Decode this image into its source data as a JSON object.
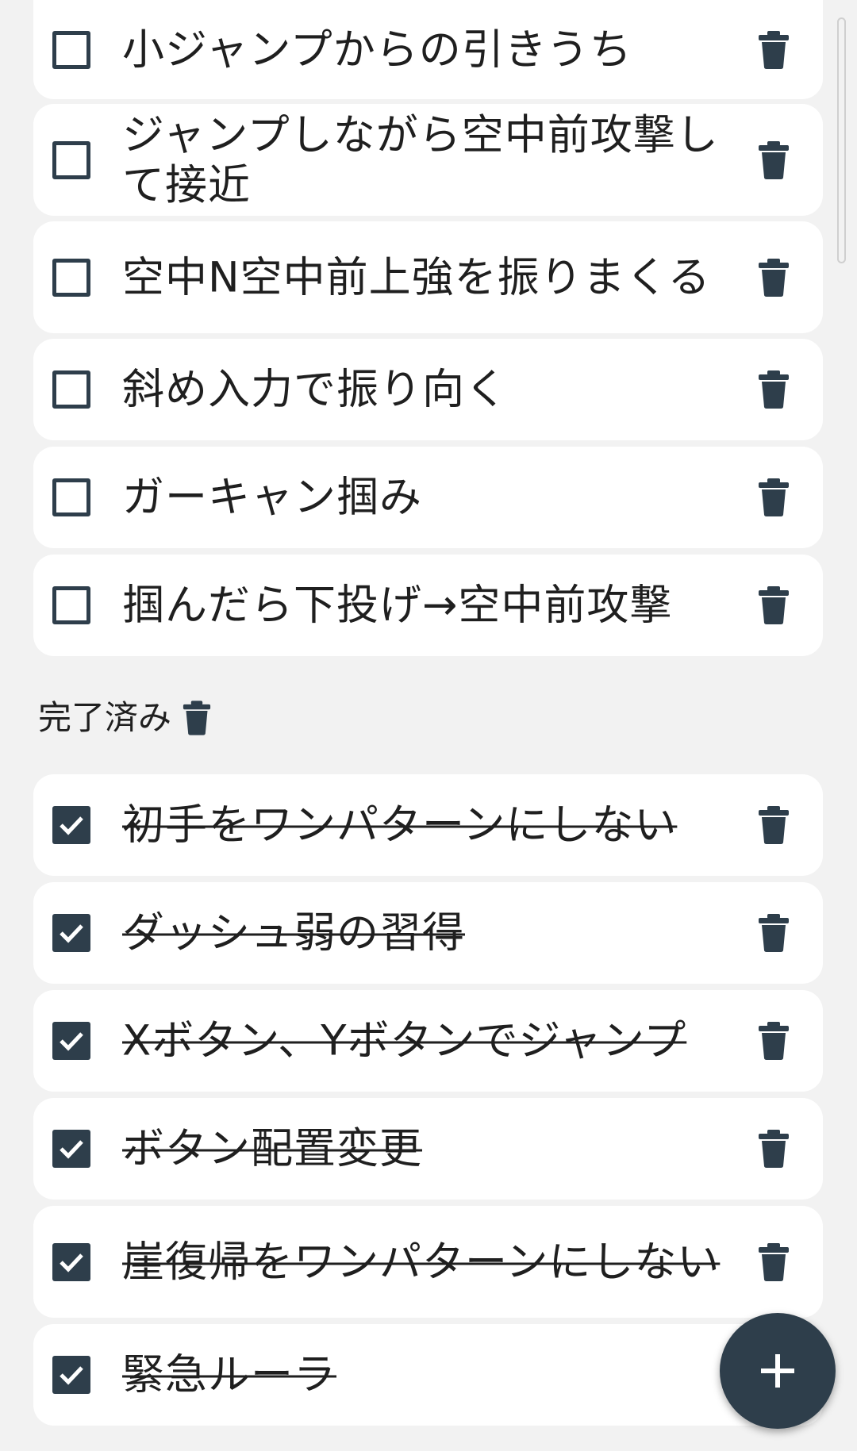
{
  "active_tasks": [
    {
      "label": "小ジャンプからの引きうち",
      "checked": false
    },
    {
      "label": "ジャンプしながら空中前攻撃して接近",
      "checked": false
    },
    {
      "label": "空中N空中前上強を振りまくる",
      "checked": false
    },
    {
      "label": "斜め入力で振り向く",
      "checked": false
    },
    {
      "label": "ガーキャン掴み",
      "checked": false
    },
    {
      "label": "掴んだら下投げ→空中前攻撃",
      "checked": false
    }
  ],
  "completed_section": {
    "title": "完了済み",
    "icon": "trash-icon"
  },
  "completed_tasks": [
    {
      "label": "初手をワンパターンにしない",
      "checked": true
    },
    {
      "label": "ダッシュ弱の習得",
      "checked": true
    },
    {
      "label": "Xボタン、Yボタンでジャンプ",
      "checked": true
    },
    {
      "label": "ボタン配置変更",
      "checked": true
    },
    {
      "label": "崖復帰をワンパターンにしない",
      "checked": true
    },
    {
      "label": "緊急ルーラ",
      "checked": true
    }
  ],
  "fab": {
    "icon": "plus-icon"
  },
  "colors": {
    "accent": "#2e3e4b",
    "card": "#ffffff",
    "background": "#f2f2f2"
  }
}
